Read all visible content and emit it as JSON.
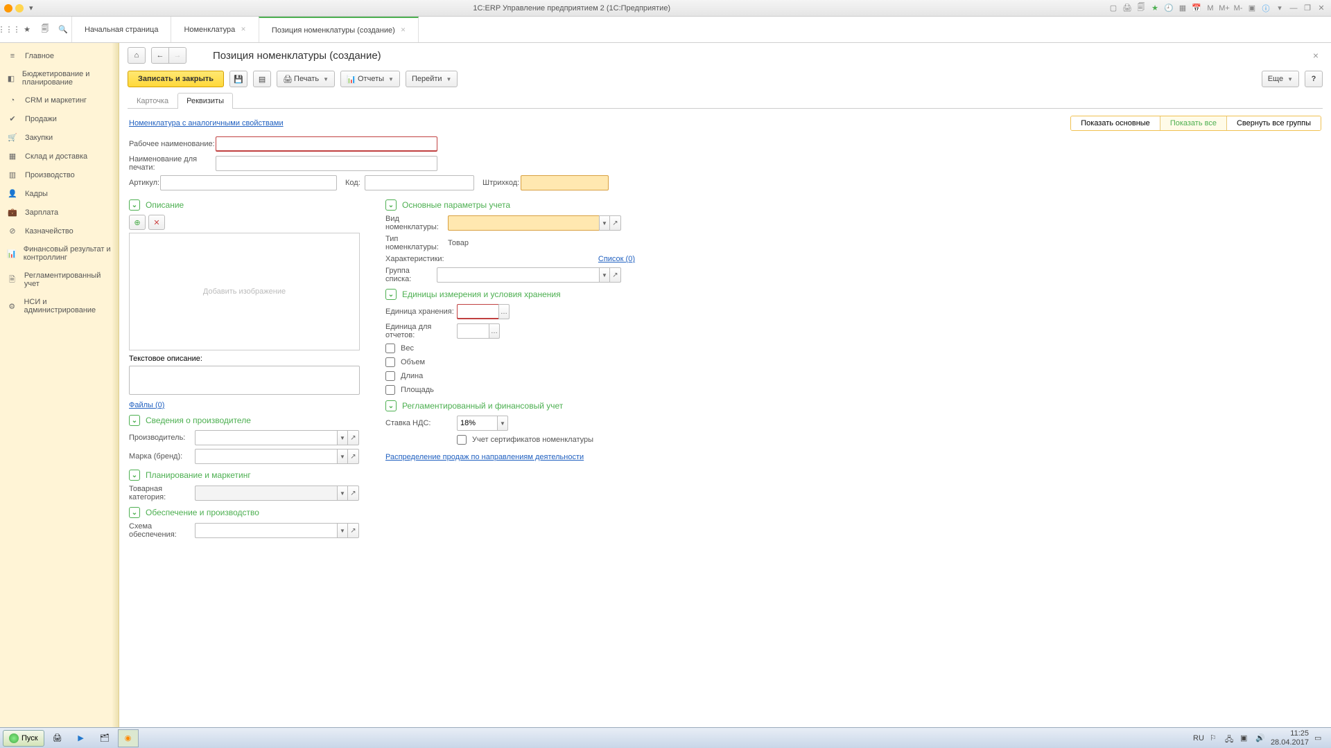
{
  "titlebar": {
    "app_title": "1С:ERP Управление предприятием 2  (1С:Предприятие)",
    "m_labels": [
      "M",
      "M+",
      "M-"
    ]
  },
  "appbar": {
    "tabs": [
      {
        "label": "Начальная страница",
        "closable": false
      },
      {
        "label": "Номенклатура",
        "closable": true
      },
      {
        "label": "Позиция номенклатуры (создание)",
        "closable": true
      }
    ]
  },
  "sidebar": {
    "items": [
      {
        "icon": "≡",
        "label": "Главное"
      },
      {
        "icon": "◧",
        "label": "Бюджетирование и планирование"
      },
      {
        "icon": "◔",
        "label": "CRM и маркетинг"
      },
      {
        "icon": "✔",
        "label": "Продажи"
      },
      {
        "icon": "🛒",
        "label": "Закупки"
      },
      {
        "icon": "▦",
        "label": "Склад и доставка"
      },
      {
        "icon": "▥",
        "label": "Производство"
      },
      {
        "icon": "👤",
        "label": "Кадры"
      },
      {
        "icon": "💼",
        "label": "Зарплата"
      },
      {
        "icon": "⊘",
        "label": "Казначейство"
      },
      {
        "icon": "📊",
        "label": "Финансовый результат и контроллинг"
      },
      {
        "icon": "🗎",
        "label": "Регламентированный учет"
      },
      {
        "icon": "⚙",
        "label": "НСИ и администрирование"
      }
    ]
  },
  "page": {
    "title": "Позиция номенклатуры (создание)"
  },
  "toolbar": {
    "save_close": "Записать и закрыть",
    "print": "Печать",
    "reports": "Отчеты",
    "goto": "Перейти",
    "more": "Еще",
    "help": "?"
  },
  "subtabs": {
    "card": "Карточка",
    "requisites": "Реквизиты"
  },
  "form": {
    "similar_link": "Номенклатура с аналогичными свойствами",
    "view_switch": {
      "main": "Показать основные",
      "all": "Показать все",
      "collapse": "Свернуть все группы"
    },
    "labels": {
      "work_name": "Рабочее наименование:",
      "print_name": "Наименование для печати:",
      "article": "Артикул:",
      "code": "Код:",
      "barcode": "Штрихкод:",
      "description": "Описание",
      "add_image": "Добавить изображение",
      "text_desc": "Текстовое описание:",
      "files": "Файлы (0)",
      "manufacturer_section": "Сведения о производителе",
      "manufacturer": "Производитель:",
      "brand": "Марка (бренд):",
      "planning_section": "Планирование и маркетинг",
      "product_category": "Товарная категория:",
      "supply_section": "Обеспечение и производство",
      "supply_scheme": "Схема обеспечения:",
      "main_params": "Основные параметры учета",
      "nomenclature_type": "Вид номенклатуры:",
      "type_nom": "Тип номенклатуры:",
      "type_nom_val": "Товар",
      "characteristics": "Характеристики:",
      "char_list": "Список (0)",
      "list_group": "Группа списка:",
      "units_section": "Единицы измерения и условия хранения",
      "storage_unit": "Единица хранения:",
      "report_unit": "Единица для отчетов:",
      "weight": "Вес",
      "volume": "Объем",
      "length": "Длина",
      "area": "Площадь",
      "regfin_section": "Регламентированный и финансовый учет",
      "vat_rate": "Ставка НДС:",
      "vat_value": "18%",
      "cert_accounting": "Учет сертификатов номенклатуры",
      "sales_distribution": "Распределение продаж по направлениям деятельности"
    }
  },
  "taskbar": {
    "start": "Пуск",
    "lang": "RU",
    "time": "11:25",
    "date": "28.04.2017"
  }
}
